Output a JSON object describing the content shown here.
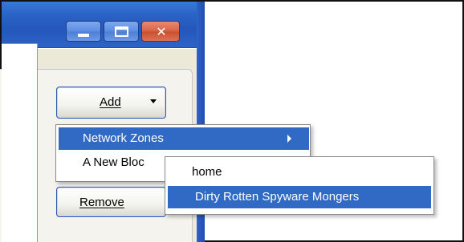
{
  "window": {
    "title_buttons": {
      "minimize_icon": "minimize-icon",
      "maximize_icon": "maximize-icon",
      "close_icon": "close-icon",
      "close_glyph": "✕"
    }
  },
  "buttons": {
    "add_label": "Add",
    "remove_label": "Remove"
  },
  "context_menu": {
    "items": [
      {
        "label": "Network Zones",
        "highlighted": true,
        "has_submenu": true
      },
      {
        "label": "A New Bloc",
        "highlighted": false,
        "has_submenu": false
      }
    ]
  },
  "submenu": {
    "items": [
      {
        "label": "home",
        "highlighted": false
      },
      {
        "label": "Dirty Rotten Spyware Mongers",
        "highlighted": true
      }
    ]
  },
  "colors": {
    "highlight": "#316ac5",
    "titlebar": "#2557bc",
    "close_button": "#d9664a"
  }
}
